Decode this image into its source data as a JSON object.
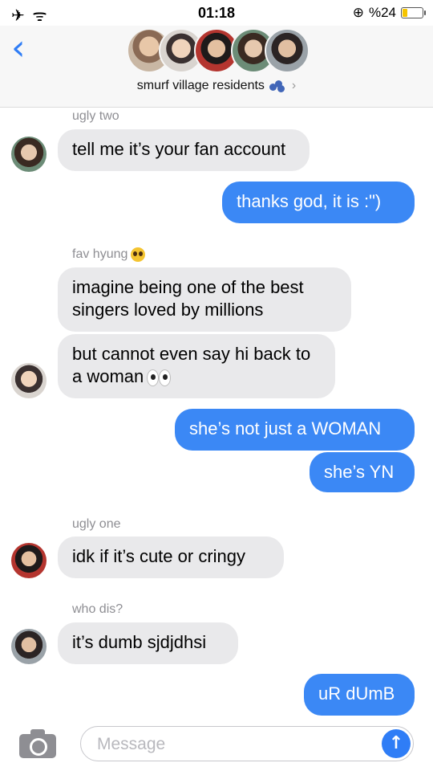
{
  "status_bar": {
    "left_icons": "✈ ᯤ",
    "time": "01:18",
    "lock_icon": "⊕",
    "battery_label": "%24",
    "battery_level": 0.24
  },
  "header": {
    "back_icon": "‹",
    "group_name": "smurf village residents",
    "chevron": "›",
    "avatar_names": [
      "avatar-1",
      "avatar-2",
      "avatar-3",
      "avatar-4",
      "avatar-5"
    ]
  },
  "messages": [
    {
      "kind": "sender",
      "text": "ugly two"
    },
    {
      "kind": "in",
      "text": "tell me it’s your fan account"
    },
    {
      "kind": "out",
      "text": "thanks god, it is :\")"
    },
    {
      "kind": "sender",
      "text": "fav hyung"
    },
    {
      "kind": "in",
      "text": "imagine being one of the best singers loved by millions"
    },
    {
      "kind": "in",
      "text": "but cannot even say hi back to a woman"
    },
    {
      "kind": "out",
      "text": "she’s not just a WOMAN"
    },
    {
      "kind": "out",
      "text": "she’s YN"
    },
    {
      "kind": "sender",
      "text": "ugly one"
    },
    {
      "kind": "in",
      "text": "idk if it’s cute or cringy"
    },
    {
      "kind": "sender",
      "text": "who dis?"
    },
    {
      "kind": "in",
      "text": "it’s dumb sjdjdhsi"
    },
    {
      "kind": "out",
      "text": "uR dUmB"
    }
  ],
  "composer": {
    "placeholder": "Message",
    "send_icon": "↑"
  },
  "colors": {
    "accent": "#2f7df6",
    "outgoing_bubble": "#3b88f5",
    "incoming_bubble": "#e9e9eb",
    "meta_text": "#8e8e93"
  }
}
